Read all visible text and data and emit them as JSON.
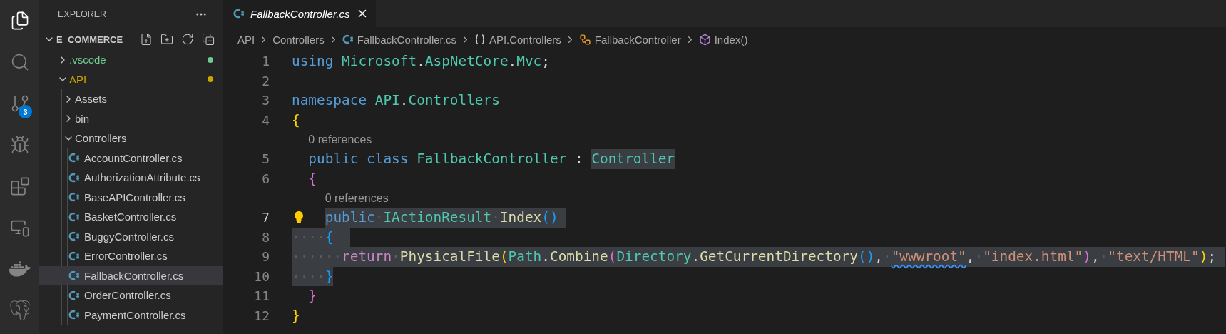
{
  "activity_bar": [
    {
      "kind": "files",
      "selected": true
    },
    {
      "kind": "search",
      "selected": false
    },
    {
      "kind": "source-control",
      "selected": false,
      "badge": "3"
    },
    {
      "kind": "run-debug",
      "selected": false
    },
    {
      "kind": "extensions",
      "selected": false
    },
    {
      "kind": "remote",
      "selected": false
    },
    {
      "kind": "docker",
      "selected": false
    },
    {
      "kind": "database",
      "selected": false
    }
  ],
  "sidebar": {
    "title": "EXPLORER",
    "section": {
      "title": "E_COMMERCE",
      "expanded": true
    },
    "tree": [
      {
        "label": ".vscode",
        "kind": "folder",
        "expanded": false,
        "selected": false,
        "color": "#73c991"
      },
      {
        "label": "API",
        "kind": "folder",
        "expanded": true,
        "selected": false,
        "color": "#cca700",
        "children": [
          {
            "label": "Assets",
            "kind": "folder",
            "expanded": false,
            "selected": false
          },
          {
            "label": "bin",
            "kind": "folder",
            "expanded": false,
            "selected": false
          },
          {
            "label": "Controllers",
            "kind": "folder",
            "expanded": true,
            "selected": false,
            "children": [
              {
                "label": "AccountController.cs",
                "kind": "file",
                "selected": false
              },
              {
                "label": "AuthorizationAttribute.cs",
                "kind": "file",
                "selected": false
              },
              {
                "label": "BaseAPIController.cs",
                "kind": "file",
                "selected": false
              },
              {
                "label": "BasketController.cs",
                "kind": "file",
                "selected": false
              },
              {
                "label": "BuggyController.cs",
                "kind": "file",
                "selected": false
              },
              {
                "label": "ErrorController.cs",
                "kind": "file",
                "selected": false
              },
              {
                "label": "FallbackController.cs",
                "kind": "file",
                "selected": true
              },
              {
                "label": "OrderController.cs",
                "kind": "file",
                "selected": false
              },
              {
                "label": "PaymentController.cs",
                "kind": "file",
                "selected": false
              }
            ]
          }
        ]
      }
    ]
  },
  "tabs": [
    {
      "label": "FallbackController.cs",
      "selected": true,
      "preview": true
    }
  ],
  "breadcrumbs": [
    {
      "label": "API",
      "kind": "folder"
    },
    {
      "label": "Controllers",
      "kind": "folder"
    },
    {
      "label": "FallbackController.cs",
      "kind": "file"
    },
    {
      "label": "API.Controllers",
      "kind": "namespace"
    },
    {
      "label": "FallbackController",
      "kind": "class"
    },
    {
      "label": "Index()",
      "kind": "method"
    }
  ],
  "code": [
    {
      "number": "1",
      "active": false,
      "tokens": [
        {
          "text": "using",
          "kind": "keyword",
          "selected": false
        },
        {
          "text": " Microsoft",
          "kind": "type",
          "selected": false
        },
        {
          "text": ".",
          "kind": "punct",
          "selected": false
        },
        {
          "text": "AspNetCore",
          "kind": "type",
          "selected": false
        },
        {
          "text": ".",
          "kind": "punct",
          "selected": false
        },
        {
          "text": "Mvc",
          "kind": "type",
          "selected": false
        },
        {
          "text": ";",
          "kind": "punct",
          "selected": false
        }
      ]
    },
    {
      "number": "2",
      "active": false
    },
    {
      "number": "3",
      "active": false,
      "tokens": [
        {
          "text": "namespace",
          "kind": "keyword",
          "selected": false
        },
        {
          "text": " API",
          "kind": "type",
          "selected": false
        },
        {
          "text": ".",
          "kind": "punct",
          "selected": false
        },
        {
          "text": "Controllers",
          "kind": "type",
          "selected": false
        }
      ]
    },
    {
      "number": "4",
      "active": false,
      "tokens": [
        {
          "text": "{",
          "kind": "bracket1",
          "selected": false
        }
      ]
    },
    {
      "number": "5",
      "active": false,
      "lens": "0 references",
      "tokens": [
        {
          "text": "  public",
          "kind": "keyword",
          "selected": false
        },
        {
          "text": " class",
          "kind": "keyword",
          "selected": false
        },
        {
          "text": " FallbackController",
          "kind": "type",
          "selected": false
        },
        {
          "text": " : ",
          "kind": "punct",
          "selected": false
        },
        {
          "text": "Controller",
          "kind": "type",
          "selected": true
        }
      ]
    },
    {
      "number": "6",
      "active": false,
      "tokens": [
        {
          "text": "  {",
          "kind": "bracket2",
          "selected": false
        }
      ]
    },
    {
      "number": "7",
      "active": true,
      "lens": "0 references",
      "lightbulb": true,
      "tokens": [
        {
          "text": "    public",
          "kind": "keyword",
          "selected": true
        },
        {
          "text": "·",
          "kind": "ws",
          "selected": true
        },
        {
          "text": "IActionResult",
          "kind": "type",
          "selected": true
        },
        {
          "text": "·",
          "kind": "ws",
          "selected": true
        },
        {
          "text": "Index",
          "kind": "method",
          "selected": true
        },
        {
          "text": "() ",
          "kind": "bracket3",
          "selected": true
        }
      ]
    },
    {
      "number": "8",
      "active": false,
      "tokens": [
        {
          "text": "····",
          "kind": "ws",
          "selected": true
        },
        {
          "text": "{  ",
          "kind": "bracket3",
          "selected": true
        }
      ]
    },
    {
      "number": "9",
      "active": false,
      "tokens": [
        {
          "text": "······",
          "kind": "ws",
          "selected": true
        },
        {
          "text": "return",
          "kind": "control",
          "selected": true
        },
        {
          "text": "·",
          "kind": "ws",
          "selected": true
        },
        {
          "text": "PhysicalFile",
          "kind": "method",
          "selected": true
        },
        {
          "text": "(",
          "kind": "bracket1",
          "selected": true
        },
        {
          "text": "Path",
          "kind": "type",
          "selected": true
        },
        {
          "text": ".",
          "kind": "punct",
          "selected": true
        },
        {
          "text": "Combine",
          "kind": "method",
          "selected": true
        },
        {
          "text": "(",
          "kind": "bracket2",
          "selected": true
        },
        {
          "text": "Directory",
          "kind": "type",
          "selected": true
        },
        {
          "text": ".",
          "kind": "punct",
          "selected": true
        },
        {
          "text": "GetCurrentDirectory",
          "kind": "method",
          "selected": true
        },
        {
          "text": "()",
          "kind": "bracket3",
          "selected": true
        },
        {
          "text": ",",
          "kind": "punct",
          "selected": true
        },
        {
          "text": "·",
          "kind": "ws",
          "selected": true
        },
        {
          "text": "\"wwwroot\"",
          "kind": "string",
          "selected": true,
          "squiggle": true
        },
        {
          "text": ",",
          "kind": "punct",
          "selected": true
        },
        {
          "text": "·",
          "kind": "ws",
          "selected": true
        },
        {
          "text": "\"index.html\"",
          "kind": "string",
          "selected": true
        },
        {
          "text": ")",
          "kind": "bracket2",
          "selected": true
        },
        {
          "text": ",",
          "kind": "punct",
          "selected": true
        },
        {
          "text": "·",
          "kind": "ws",
          "selected": true
        },
        {
          "text": "\"text/HTML\"",
          "kind": "string",
          "selected": true
        },
        {
          "text": ")",
          "kind": "bracket1",
          "selected": true
        },
        {
          "text": "; ",
          "kind": "punct",
          "selected": true
        }
      ]
    },
    {
      "number": "10",
      "active": false,
      "tokens": [
        {
          "text": "····",
          "kind": "ws",
          "selected": true
        },
        {
          "text": "}",
          "kind": "bracket3",
          "selected": true
        }
      ]
    },
    {
      "number": "11",
      "active": false,
      "tokens": [
        {
          "text": "  }",
          "kind": "bracket2",
          "selected": false
        }
      ]
    },
    {
      "number": "12",
      "active": false,
      "tokens": [
        {
          "text": "}",
          "kind": "bracket1",
          "selected": false
        }
      ]
    }
  ]
}
